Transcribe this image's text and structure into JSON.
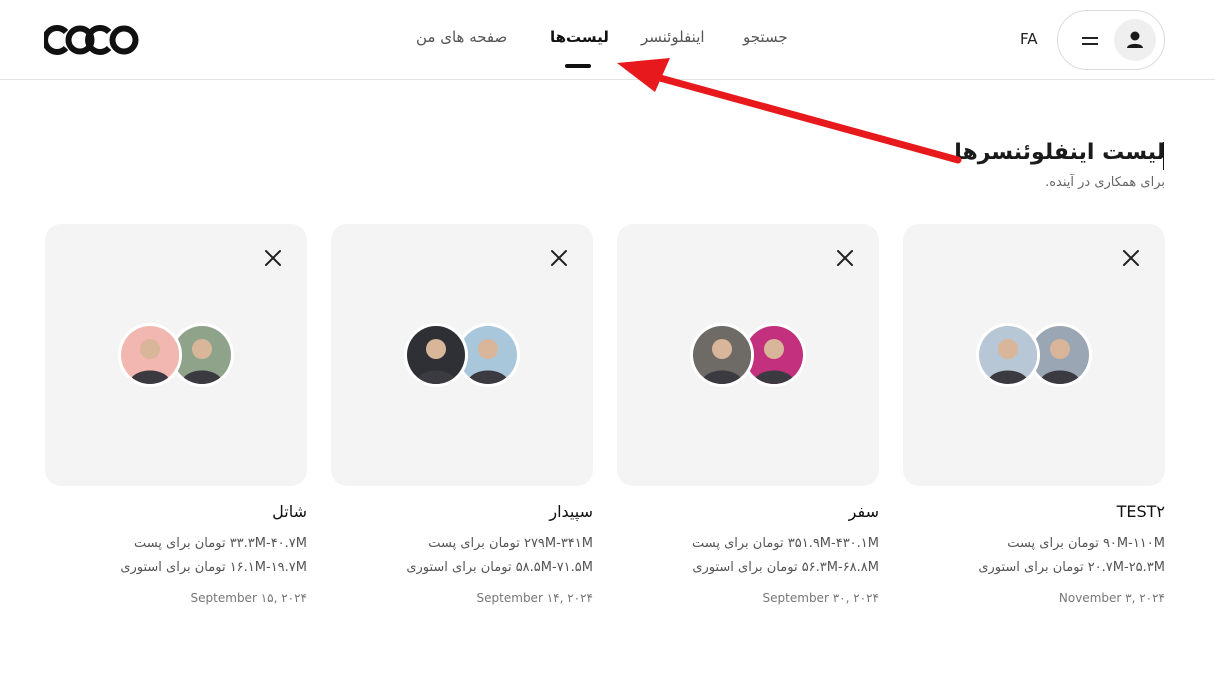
{
  "header": {
    "logo_text": "COCO",
    "nav": [
      {
        "label": "جستجو",
        "active": false
      },
      {
        "label": "اینفلوئنسر",
        "active": false
      },
      {
        "label": "لیست‌ها",
        "active": true
      },
      {
        "label": "صفحه های من",
        "active": false
      }
    ],
    "language": "FA",
    "menu_icon": "hamburger-icon",
    "user_icon": "user-icon"
  },
  "page": {
    "title": "لیست اینفلوئنسرها",
    "subtitle": "برای همکاری در آینده."
  },
  "lists": [
    {
      "name": "TEST۲",
      "post_range": "۹۰M-۱۱۰M تومان برای پست",
      "story_range": "۲۰.۷M-۲۵.۳M تومان برای استوری",
      "date": "November ۳, ۲۰۲۴",
      "avatar_colors": [
        "#b8c7d6",
        "#9aa6b4"
      ]
    },
    {
      "name": "سفر",
      "post_range": "۳۵۱.۹M-۴۳۰.۱M تومان برای پست",
      "story_range": "۵۶.۳M-۶۸.۸M تومان برای استوری",
      "date": "September ۳۰, ۲۰۲۴",
      "avatar_colors": [
        "#6e6a66",
        "#c2307e"
      ]
    },
    {
      "name": "سپیدار",
      "post_range": "۲۷۹M-۳۴۱M تومان برای پست",
      "story_range": "۵۸.۵M-۷۱.۵M تومان برای استوری",
      "date": "September ۱۴, ۲۰۲۴",
      "avatar_colors": [
        "#2f2f36",
        "#a9c7da"
      ]
    },
    {
      "name": "شاتل",
      "post_range": "۳۳.۳M-۴۰.۷M تومان برای پست",
      "story_range": "۱۶.۱M-۱۹.۷M تومان برای استوری",
      "date": "September ۱۵, ۲۰۲۴",
      "avatar_colors": [
        "#f2b7b0",
        "#8fa38a"
      ]
    }
  ],
  "icons": {
    "close": "close-icon",
    "annotation_arrow": "red-arrow-annotation"
  },
  "colors": {
    "annotation": "#e8191c",
    "card_bg": "#f4f4f4"
  }
}
